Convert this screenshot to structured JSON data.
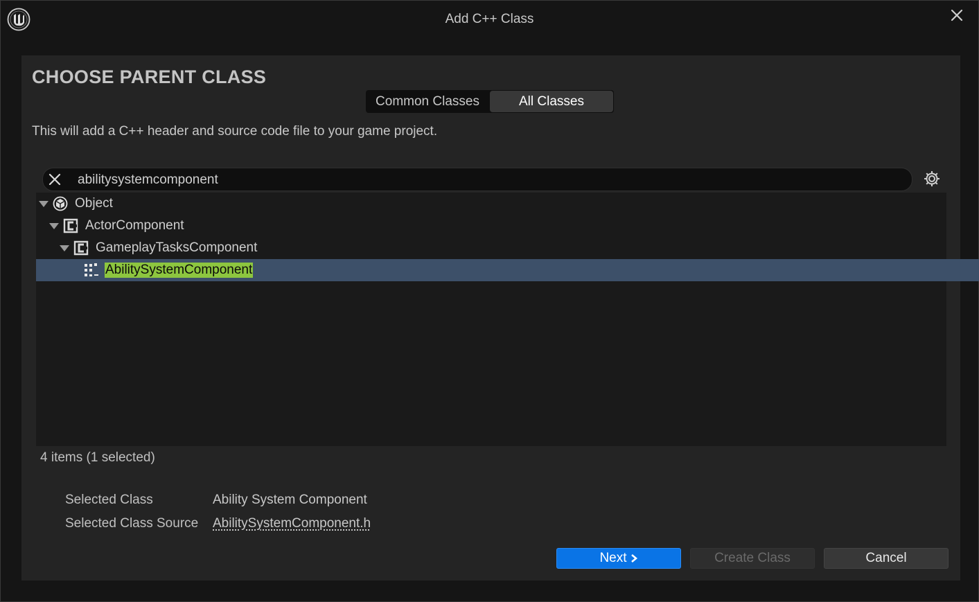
{
  "window": {
    "title": "Add C++ Class"
  },
  "header": {
    "heading": "CHOOSE PARENT CLASS",
    "tabs": [
      {
        "label": "Common Classes",
        "active": false
      },
      {
        "label": "All Classes",
        "active": true
      }
    ],
    "description": "This will add a C++ header and source code file to your game project."
  },
  "search": {
    "value": "abilitysystemcomponent",
    "clear_icon": "close-icon",
    "settings_icon": "gear-icon"
  },
  "tree": {
    "items": [
      {
        "label": "Object",
        "depth": 0,
        "expanded": true,
        "icon": "object-icon"
      },
      {
        "label": "ActorComponent",
        "depth": 1,
        "expanded": true,
        "icon": "class-icon"
      },
      {
        "label": "GameplayTasksComponent",
        "depth": 2,
        "expanded": true,
        "icon": "class-icon"
      },
      {
        "label": "AbilitySystemComponent",
        "depth": 3,
        "selected": true,
        "icon": "component-icon"
      }
    ],
    "status": "4 items (1 selected)"
  },
  "info": {
    "selected_class_label": "Selected Class",
    "selected_class_value": "Ability System Component",
    "selected_source_label": "Selected Class Source",
    "selected_source_value": "AbilitySystemComponent.h"
  },
  "buttons": {
    "next": "Next",
    "create": "Create Class",
    "cancel": "Cancel"
  },
  "colors": {
    "accent": "#0a74e6",
    "selection": "#3d5069",
    "highlight": "#8dc63f"
  }
}
